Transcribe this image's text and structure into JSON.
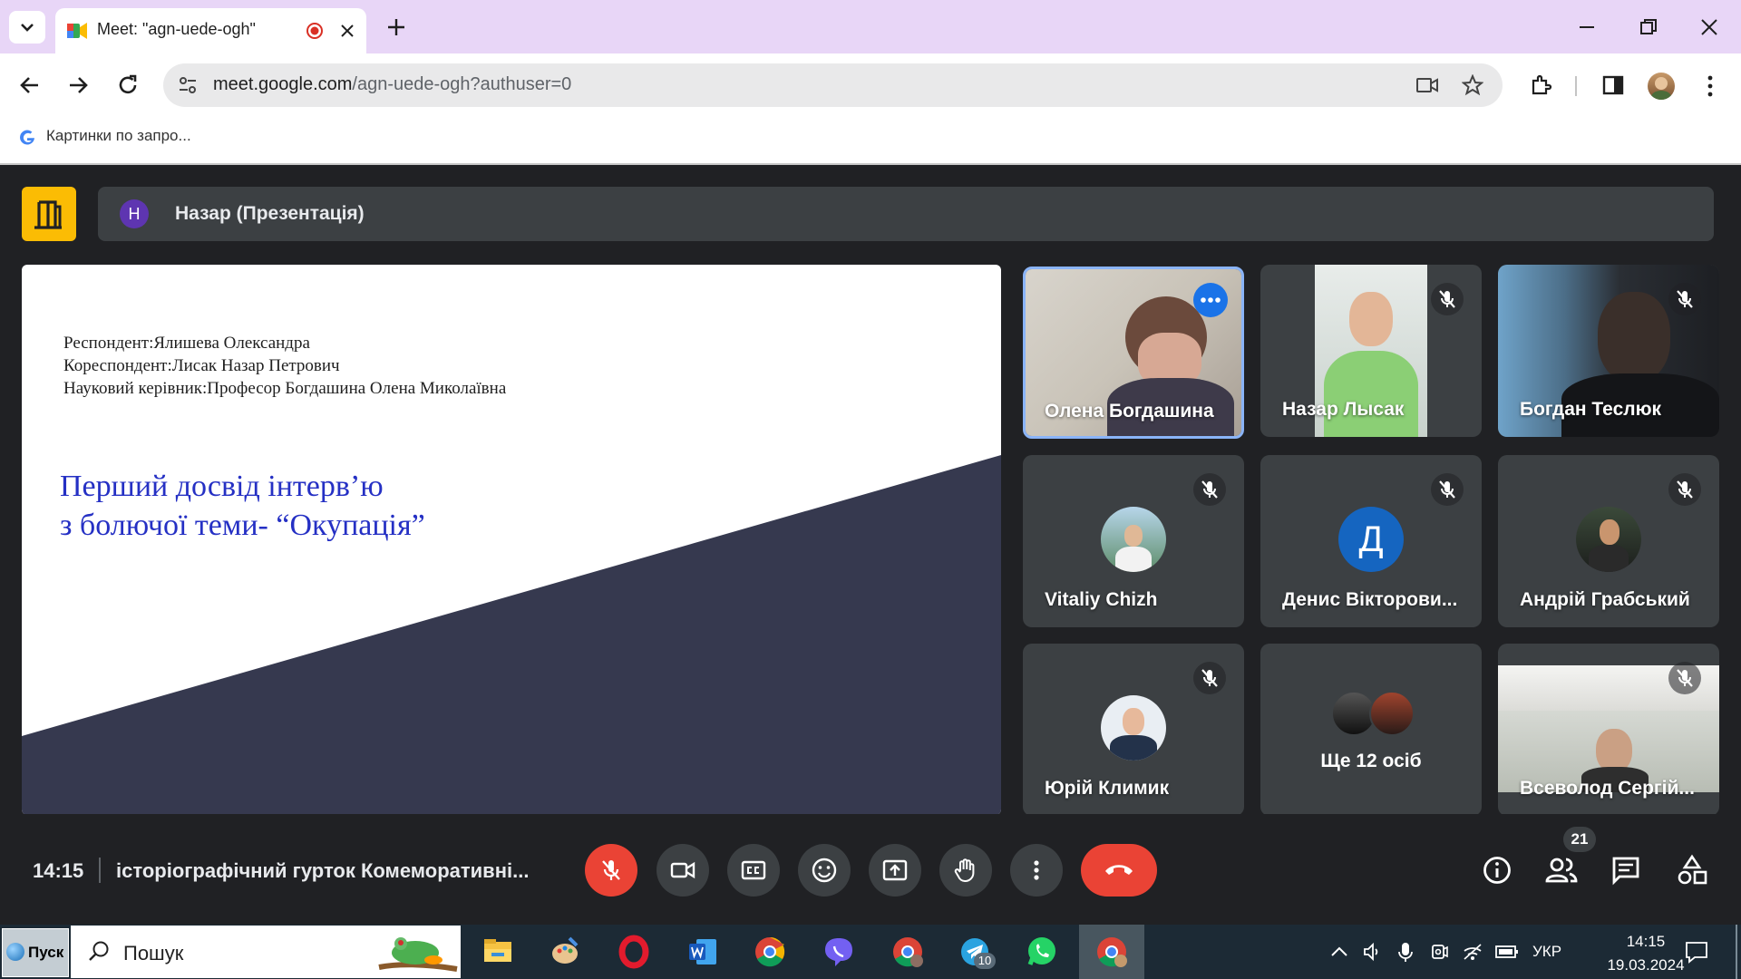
{
  "browser": {
    "tab_title": "Meet: \"agn-uede-ogh\"",
    "url_host": "meet.google.com",
    "url_path": "/agn-uede-ogh?authuser=0",
    "bookmark_label": "Картинки по запро..."
  },
  "meet": {
    "presenter_initial": "Н",
    "presenter_label": "Назар (Презентація)",
    "slide": {
      "line1": "Респондент:Ялишева Олександра",
      "line2": "Кореспондент:Лисак Назар Петрович",
      "line3": "Науковий керівник:Професор Богдашина Олена Миколаївна",
      "title1": "Перший досвід інтерв’ю",
      "title2": "з болючої теми- “Окупація”"
    },
    "participants": [
      {
        "name": "Олена Богдашина"
      },
      {
        "name": "Назар Лысак"
      },
      {
        "name": "Богдан Теслюк"
      },
      {
        "name": "Vitaliy Chizh"
      },
      {
        "name": "Денис Вікторови...",
        "initial": "Д"
      },
      {
        "name": "Андрій Грабський"
      },
      {
        "name": "Юрій Климик"
      },
      {
        "name": "Ще 12 осіб"
      },
      {
        "name": "Всеволод Сергій..."
      }
    ],
    "time": "14:15",
    "meeting_title": "історіографічний гурток Комеморативні...",
    "people_count": "21"
  },
  "taskbar": {
    "start_label": "Пуск",
    "search_placeholder": "Пошук",
    "telegram_badge": "10",
    "lang": "УКР",
    "time": "14:15",
    "date": "19.03.2024"
  },
  "colors": {
    "tabbar": "#e8d6f7",
    "meet_bg": "#202124",
    "tile": "#3c4043",
    "end_call": "#ea4335",
    "accent_blue": "#8ab4f8"
  }
}
